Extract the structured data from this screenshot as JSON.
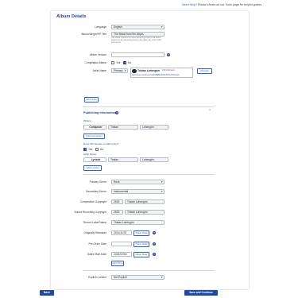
{
  "help": {
    "link": "Need Help?",
    "text": " Please check out our Tools page for helpful guides"
  },
  "card_title": "Album Details",
  "language": {
    "label": "Language",
    "value": "English"
  },
  "album_title": {
    "label": "Album/Single/EP Title",
    "value": "The Beast from the Abyss",
    "note": "Title stated indicates the same Streaming Artists for all tracks, please see the Streaming Artists in the album title in the Track preferences"
  },
  "album_version": {
    "label": "Album Version",
    "value": ""
  },
  "compilation": {
    "label": "Compilation Album",
    "yes": "Yes",
    "no": "No",
    "selected": "No"
  },
  "artist": {
    "label": "Artist Name",
    "role": "Primary",
    "name": "Tristan Lohengrin",
    "meta": "160 Followers",
    "link": "https://open.spotify.com/artist/5BBiRCtGZJ6NYxTP10cQ2f",
    "change": "Change"
  },
  "add_artist": "Add Artist",
  "publishing": {
    "title": "Publishing Information",
    "writers_label": "Writers",
    "writer": {
      "role": "Composer",
      "first": "Tristan",
      "last": "Lohengrin"
    },
    "add_composer": "Add Composer",
    "lyrics_question": "Does this release contain lyrics?",
    "yes": "Yes",
    "no": "No",
    "selected": "Yes",
    "lyricist_label": "Artist Name",
    "lyricist": {
      "role": "Lyricist",
      "first": "Tristan",
      "last": "Lohengrin"
    },
    "add_lyricist": "Add Lyricist"
  },
  "primary_genre": {
    "label": "Primary Genre",
    "value": "Rock"
  },
  "secondary_genre": {
    "label": "Secondary Genre",
    "value": "Instrumental"
  },
  "comp_copyright": {
    "label": "Composition Copyright",
    "year": "2023",
    "owner": "Tristan Lohengrin"
  },
  "sound_copyright": {
    "label": "Sound Recording Copyright",
    "year": "2023",
    "owner": "Tristan Lohengrin"
  },
  "record_label": {
    "label": "Record Label Name",
    "value": "Tristan Lohengrin"
  },
  "orig_released": {
    "label": "Originally Released",
    "value": "2014/11/22",
    "clear": "Clear Date"
  },
  "preorder": {
    "label": "Pre-Order Date",
    "value": "",
    "clear": "Clear Date"
  },
  "sales_start": {
    "label": "Sales Start Date",
    "value": "2024/02/18",
    "clear": "Clear Date"
  },
  "add_time": "Add Time",
  "explicit": {
    "label": "Explicit Content",
    "value": "Not Explicit"
  },
  "footer": {
    "back": "Back",
    "save": "Save and Continue"
  },
  "colors": {
    "accent": "#1f49a8",
    "link": "#2a63d4"
  }
}
